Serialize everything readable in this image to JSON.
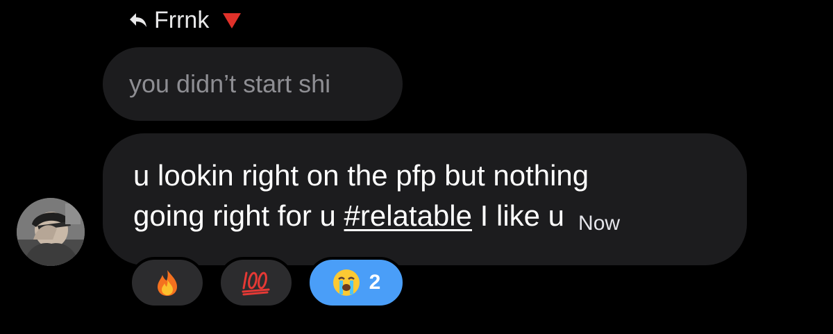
{
  "reply_header": {
    "icon": "reply-arrow-icon",
    "name": "Frrnk",
    "flag_icon": "red-triangle-down-icon"
  },
  "quoted_message": {
    "text": "you didn’t start shi"
  },
  "message": {
    "line1": "u lookin right on the pfp but nothing",
    "line2_prefix": "going right for u ",
    "hashtag": "#relatable",
    "line2_suffix": " I like u",
    "timestamp": "Now"
  },
  "avatar": {
    "icon": "user-avatar"
  },
  "reactions": [
    {
      "emoji": "🔥",
      "icon": "fire-emoji-icon",
      "count": ""
    },
    {
      "emoji": "💯",
      "icon": "hundred-points-emoji-icon",
      "count": ""
    },
    {
      "emoji": "😭",
      "icon": "loudly-crying-face-emoji-icon",
      "count": "2",
      "selected": true
    }
  ],
  "colors": {
    "background": "#000000",
    "bubble": "#1c1c1e",
    "quoted_text": "#8e8e93",
    "selected_reaction": "#4a9ef8",
    "reaction_pill": "#2c2c2e",
    "flag": "#e0312a"
  }
}
